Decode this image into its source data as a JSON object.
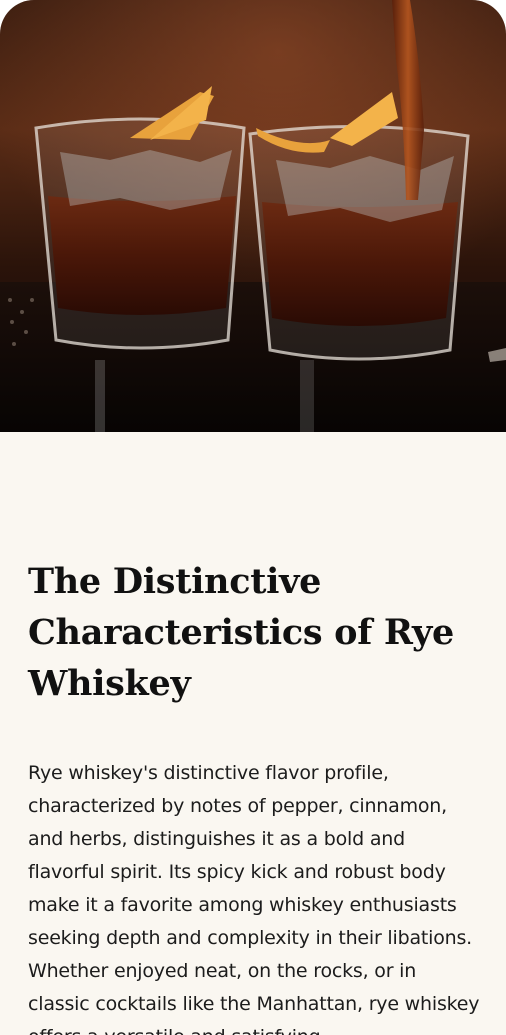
{
  "article": {
    "hero_image": "two-glasses-of-rye-whiskey-with-orange-peel-being-poured",
    "headline": "The Distinctive Characteristics of Rye Whiskey",
    "body": "Rye whiskey's distinctive flavor profile, characterized by notes of pepper, cinnamon, and herbs, distinguishes it as a bold and flavorful spirit. Its spicy kick and robust body make it a favorite among whiskey enthusiasts seeking depth and complexity in their libations. Whether enjoyed neat, on the rocks, or in classic cocktails like the Manhattan, rye whiskey offers a versatile and satisfying"
  },
  "colors": {
    "page_background": "#faf7f1",
    "headline": "#111111",
    "body_text": "#1c1c1c"
  }
}
